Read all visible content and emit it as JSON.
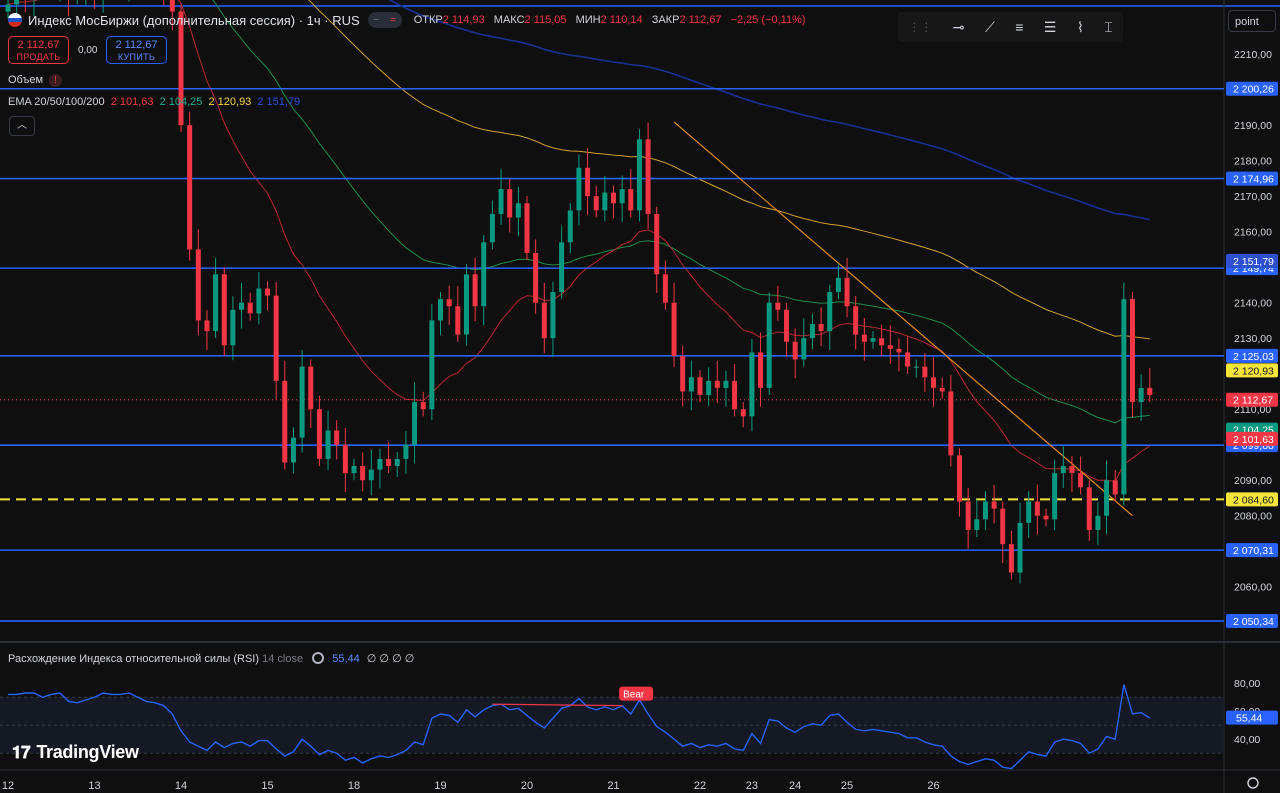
{
  "header": {
    "title": "Индекс МосБиржи (дополнительная сессия) · 1ч · RUS",
    "ohlc": [
      {
        "label": "ОТКР",
        "value": "2 114,93"
      },
      {
        "label": "МАКС",
        "value": "2 115,05"
      },
      {
        "label": "МИН",
        "value": "2 110,14"
      },
      {
        "label": "ЗАКР",
        "value": "2 112,67"
      }
    ],
    "change": "−2,25 (−0,11%)"
  },
  "trade": {
    "sell_price": "2 112,67",
    "sell_label": "ПРОДАТЬ",
    "spread": "0,00",
    "buy_price": "2 112,67",
    "buy_label": "КУПИТЬ"
  },
  "volume_label": "Объем",
  "ema": {
    "label": "EMA 20/50/100/200",
    "values": [
      "2 101,63",
      "2 104,25",
      "2 120,93",
      "2 151,79"
    ]
  },
  "point_label": "point",
  "rsi": {
    "label": "Расхождение Индекса относительной силы (RSI)",
    "params": "14 close",
    "value": "55,44",
    "extras": "∅ ∅ ∅ ∅"
  },
  "branding": "TradingView",
  "colors": {
    "up": "#089981",
    "down": "#f23645",
    "level": "#2962ff",
    "ema20": "#b22833",
    "ema50": "#1f8a4c",
    "ema100": "#d1a02e",
    "ema200": "#1c2f8f",
    "rsi": "#2962ff",
    "dashed": "#f5e53b",
    "trend": "#e08a1e"
  },
  "chart_data": {
    "type": "candlestick",
    "ylim": [
      2045,
      2223
    ],
    "rsi_ylim": [
      18,
      88
    ],
    "y_ticks": [
      "2210,00",
      "2190,00",
      "2180,00",
      "2170,00",
      "2160,00",
      "2140,00",
      "2130,00",
      "2110,00",
      "2090,00",
      "2080,00",
      "2060,00"
    ],
    "rsi_ticks": [
      "80,00",
      "60,00",
      "40,00"
    ],
    "x_ticks": [
      "12",
      "13",
      "14",
      "15",
      "18",
      "19",
      "20",
      "21",
      "22",
      "23",
      "24",
      "25",
      "26"
    ],
    "levels": [
      {
        "value": 2200.26,
        "label": "2 200,26"
      },
      {
        "value": 2174.96,
        "label": "2 174,96"
      },
      {
        "value": 2149.74,
        "label": "2 149,74"
      },
      {
        "value": 2125.03,
        "label": "2 125,03"
      },
      {
        "value": 2099.88,
        "label": "2 099,88"
      },
      {
        "value": 2070.31,
        "label": "2 070,31"
      },
      {
        "value": 2050.34,
        "label": "2 050,34"
      }
    ],
    "dashed_level": {
      "value": 2084.6,
      "label": "2 084,60"
    },
    "price_tags": [
      {
        "value": 2151.79,
        "label": "2 151,79",
        "key": "ema200"
      },
      {
        "value": 2120.93,
        "label": "2 120,93",
        "key": "ema100"
      },
      {
        "value": 2112.67,
        "label": "2 112,67",
        "key": "down"
      },
      {
        "value": 2104.25,
        "label": "2 104,25",
        "key": "ema50"
      },
      {
        "value": 2101.63,
        "label": "2 101,63",
        "key": "ema20"
      }
    ],
    "last_price": 2112.67,
    "rsi_value": 55.44,
    "rsi_label": "55,44",
    "annotation": "Bear",
    "x_range": [
      0,
      132
    ],
    "day_bars": [
      0,
      10,
      20,
      30,
      40,
      50,
      60,
      70,
      80,
      86,
      91,
      97,
      107
    ],
    "close": [
      2224,
      2230,
      2226,
      2228,
      2232,
      2229,
      2231,
      2226,
      2227,
      2229,
      2227,
      2231,
      2230,
      2229,
      2233,
      2231,
      2230,
      2229,
      2228,
      2222,
      2190,
      2155,
      2135,
      2132,
      2148,
      2128,
      2138,
      2140,
      2137,
      2144,
      2142,
      2118,
      2095,
      2102,
      2122,
      2110,
      2096,
      2104,
      2100,
      2092,
      2094,
      2090,
      2093,
      2096,
      2094,
      2096,
      2100,
      2112,
      2110,
      2135,
      2141,
      2139,
      2131,
      2148,
      2139,
      2157,
      2165,
      2172,
      2164,
      2168,
      2154,
      2140,
      2130,
      2143,
      2157,
      2166,
      2178,
      2170,
      2166,
      2171,
      2168,
      2172,
      2166,
      2186,
      2165,
      2148,
      2140,
      2125,
      2115,
      2119,
      2114,
      2118,
      2116,
      2118,
      2110,
      2108,
      2126,
      2116,
      2140,
      2138,
      2129,
      2124,
      2130,
      2134,
      2132,
      2143,
      2147,
      2139,
      2131,
      2129,
      2130,
      2128,
      2127,
      2126,
      2122,
      2122,
      2119,
      2116,
      2115,
      2097,
      2084,
      2076,
      2079,
      2084,
      2082,
      2072,
      2064,
      2078,
      2084,
      2080,
      2079,
      2092,
      2094,
      2092,
      2088,
      2076,
      2080,
      2090,
      2086,
      2141,
      2112,
      2116,
      2114
    ],
    "rsi": [
      72,
      72,
      73,
      73,
      70,
      72,
      73,
      67,
      66,
      68,
      70,
      73,
      72,
      72,
      73,
      70,
      67,
      66,
      64,
      58,
      46,
      38,
      35,
      32,
      38,
      34,
      37,
      38,
      35,
      39,
      39,
      33,
      28,
      31,
      40,
      35,
      29,
      32,
      30,
      25,
      27,
      23,
      26,
      28,
      27,
      29,
      32,
      38,
      36,
      55,
      58,
      57,
      52,
      61,
      56,
      61,
      64,
      65,
      61,
      62,
      57,
      52,
      48,
      55,
      62,
      64,
      69,
      63,
      61,
      63,
      61,
      64,
      58,
      68,
      58,
      49,
      45,
      40,
      35,
      37,
      34,
      36,
      35,
      37,
      33,
      32,
      44,
      37,
      54,
      53,
      48,
      45,
      49,
      51,
      50,
      57,
      58,
      52,
      47,
      46,
      47,
      46,
      45,
      44,
      41,
      41,
      38,
      36,
      35,
      28,
      24,
      22,
      24,
      26,
      25,
      20,
      19,
      25,
      31,
      29,
      28,
      38,
      40,
      39,
      37,
      30,
      33,
      42,
      40,
      79,
      58,
      59,
      55
    ]
  }
}
